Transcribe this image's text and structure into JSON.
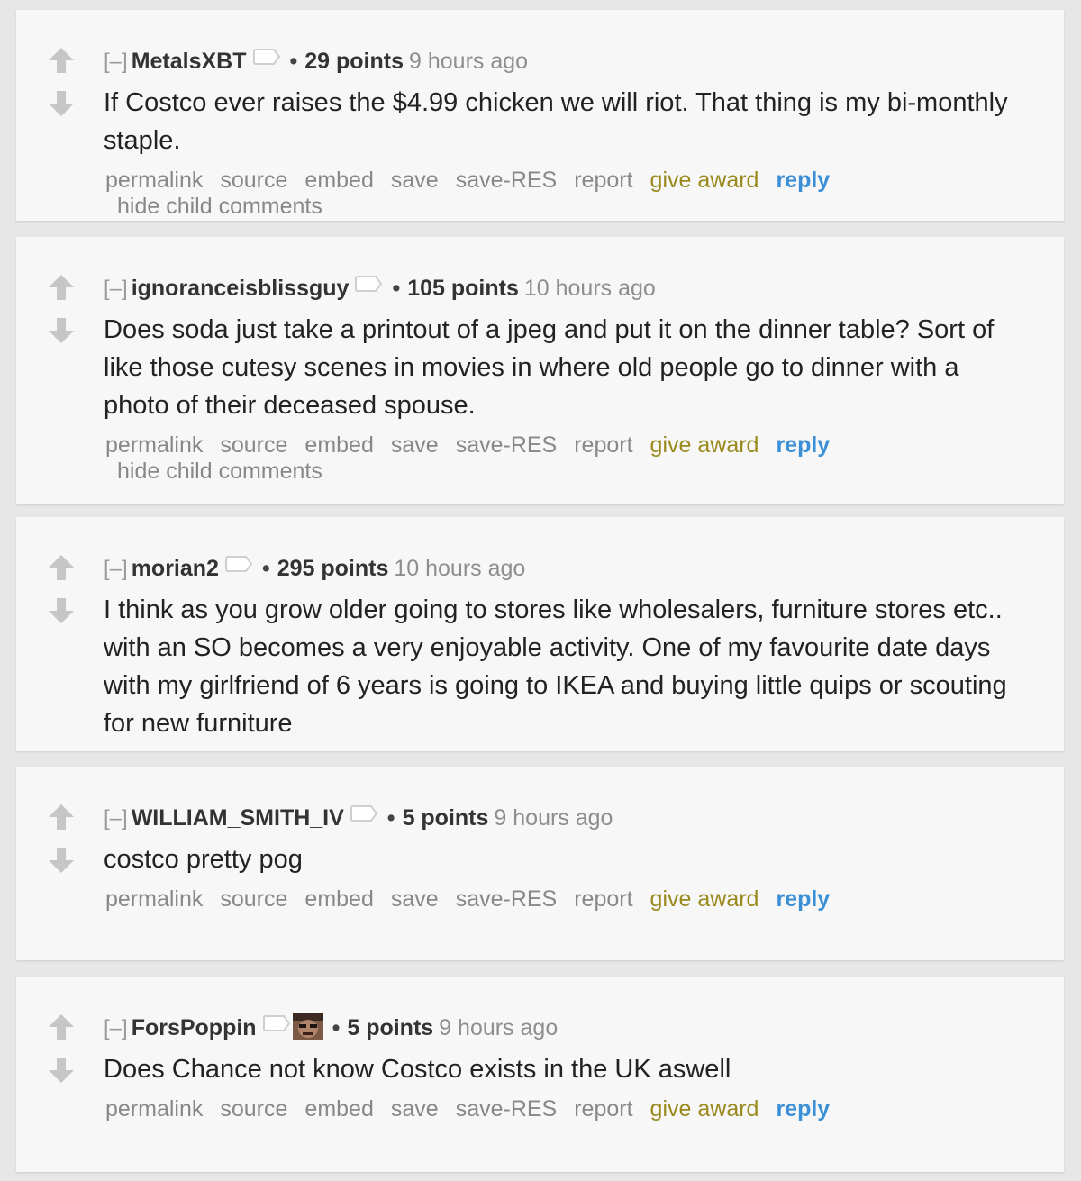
{
  "comments": [
    {
      "expand": "[–]",
      "author": "MetalsXBT",
      "bullet": "•",
      "score": "29 points",
      "time": "9 hours ago",
      "body": "If Costco ever raises the $4.99 chicken we will riot. That thing is my bi-monthly staple.",
      "hide_child": "hide child comments"
    },
    {
      "expand": "[–]",
      "author": "ignoranceisblissguy",
      "bullet": "•",
      "score": "105 points",
      "time": "10 hours ago",
      "body": "Does soda just take a printout of a jpeg and put it on the dinner table? Sort of like those cutesy scenes in movies in where old people go to dinner with a photo of their deceased spouse.",
      "hide_child": "hide child comments"
    },
    {
      "expand": "[–]",
      "author": "morian2",
      "bullet": "•",
      "score": "295 points",
      "time": "10 hours ago",
      "body": "I think as you grow older going to stores like wholesalers, furniture stores etc.. with an SO becomes a very enjoyable activity. One of my favourite date days with my girlfriend of 6 years is going to IKEA and buying little quips or scouting for new furniture"
    },
    {
      "expand": "[–]",
      "author": "WILLIAM_SMITH_IV",
      "bullet": "•",
      "score": "5 points",
      "time": "9 hours ago",
      "body": "costco pretty pog"
    },
    {
      "expand": "[–]",
      "author": "ForsPoppin",
      "bullet": "•",
      "score": "5 points",
      "time": "9 hours ago",
      "body": "Does Chance not know Costco exists in the UK aswell"
    }
  ],
  "buttons": {
    "permalink": "permalink",
    "source": "source",
    "embed": "embed",
    "save": "save",
    "save_res": "save-RES",
    "report": "report",
    "give_award": "give award",
    "reply": "reply"
  },
  "icons": {
    "upvote": "upvote-arrow-icon",
    "downvote": "downvote-arrow-icon",
    "tag": "user-tag-icon",
    "flair": "user-flair-image"
  },
  "colors": {
    "award": "#9a8a1e",
    "reply": "#3a8fd6",
    "arrow": "#c6c6c6"
  }
}
